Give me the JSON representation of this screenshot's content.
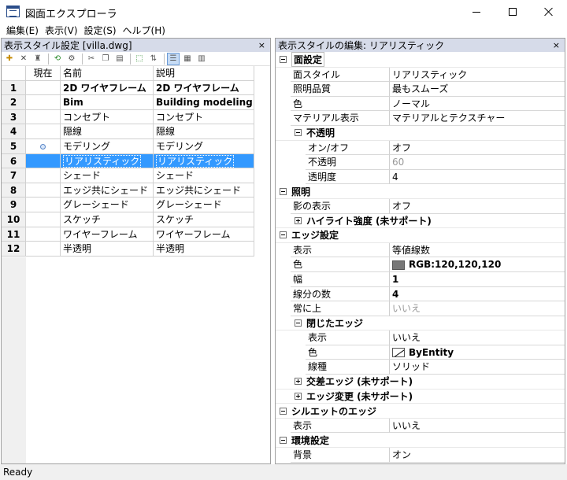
{
  "window": {
    "title": "図面エクスプローラ"
  },
  "menu": [
    "編集(E)",
    "表示(V)",
    "設定(S)",
    "ヘルプ(H)"
  ],
  "left_panel": {
    "title": "表示スタイル設定 [villa.dwg]",
    "close": "×",
    "columns": {
      "current": "現在",
      "name": "名前",
      "desc": "説明"
    },
    "rows": [
      {
        "num": "1",
        "name": "2D ワイヤフレーム",
        "desc": "2D ワイヤフレーム",
        "bold": true
      },
      {
        "num": "2",
        "name": "Bim",
        "desc": "Building modeling",
        "bold": true
      },
      {
        "num": "3",
        "name": "コンセプト",
        "desc": "コンセプト"
      },
      {
        "num": "4",
        "name": "隠線",
        "desc": "隠線"
      },
      {
        "num": "5",
        "name": "モデリング",
        "desc": "モデリング",
        "current": true
      },
      {
        "num": "6",
        "name": "リアリスティック",
        "desc": "リアリスティック",
        "selected": true
      },
      {
        "num": "7",
        "name": "シェード",
        "desc": "シェード"
      },
      {
        "num": "8",
        "name": "エッジ共にシェード",
        "desc": "エッジ共にシェード"
      },
      {
        "num": "9",
        "name": "グレーシェード",
        "desc": "グレーシェード"
      },
      {
        "num": "10",
        "name": "スケッチ",
        "desc": "スケッチ"
      },
      {
        "num": "11",
        "name": "ワイヤーフレーム",
        "desc": "ワイヤーフレーム"
      },
      {
        "num": "12",
        "name": "半透明",
        "desc": "半透明"
      }
    ]
  },
  "right_panel": {
    "title": "表示スタイルの編集: リアリスティック",
    "close": "×",
    "face": {
      "label": "面設定",
      "style_label": "面スタイル",
      "style_value": "リアリスティック",
      "lighting_quality_label": "照明品質",
      "lighting_quality_value": "最もスムーズ",
      "color_label": "色",
      "color_value": "ノーマル",
      "material_label": "マテリアル表示",
      "material_value": "マテリアルとテクスチャー",
      "opacity": {
        "label": "不透明",
        "onoff_label": "オン/オフ",
        "onoff_value": "オフ",
        "opacity_label": "不透明",
        "opacity_value": "60",
        "transparency_label": "透明度",
        "transparency_value": "4"
      }
    },
    "lighting": {
      "label": "照明",
      "shadow_label": "影の表示",
      "shadow_value": "オフ",
      "highlight_label": "ハイライト強度 (未サポート)"
    },
    "edge": {
      "label": "エッジ設定",
      "display_label": "表示",
      "display_value": "等値線数",
      "color_label": "色",
      "color_value": "RGB:120,120,120",
      "color_hex": "#787878",
      "width_label": "幅",
      "width_value": "1",
      "lines_label": "線分の数",
      "lines_value": "4",
      "ontop_label": "常に上",
      "ontop_value": "いいえ",
      "closed": {
        "label": "閉じたエッジ",
        "display_label": "表示",
        "display_value": "いいえ",
        "color_label": "色",
        "color_value": "ByEntity",
        "linetype_label": "線種",
        "linetype_value": "ソリッド"
      },
      "intersect_label": "交差エッジ (未サポート)",
      "modify_label": "エッジ変更 (未サポート)"
    },
    "silhouette": {
      "label": "シルエットのエッジ",
      "display_label": "表示",
      "display_value": "いいえ"
    },
    "environment": {
      "label": "環境設定",
      "background_label": "背景",
      "background_value": "オン"
    }
  },
  "status": "Ready"
}
